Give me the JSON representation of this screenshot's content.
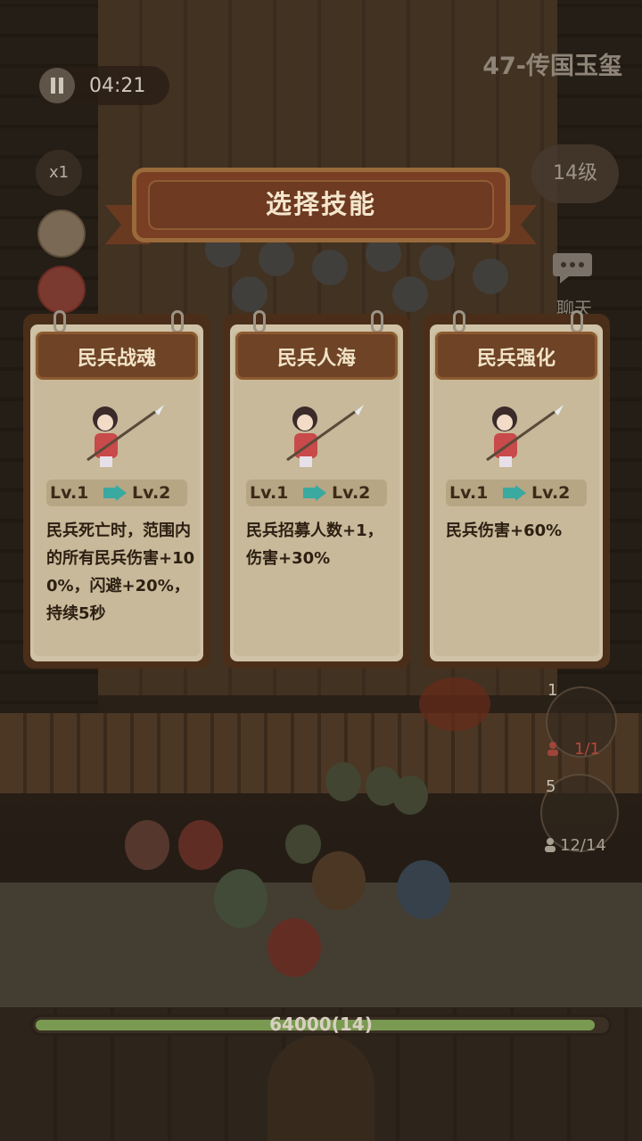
{
  "hud": {
    "timer": "04:21",
    "stage_title": "47-传国玉玺",
    "speed": "x1",
    "level": "14级",
    "chat_label": "聊天"
  },
  "dialog": {
    "title": "选择技能",
    "cards": [
      {
        "name": "民兵战魂",
        "level_from": "Lv.1",
        "level_to": "Lv.2",
        "description": "民兵死亡时，范围内的所有民兵伤害+100%，闪避+20%，持续5秒"
      },
      {
        "name": "民兵人海",
        "level_from": "Lv.1",
        "level_to": "Lv.2",
        "description": "民兵招募人数+1，伤害+30%"
      },
      {
        "name": "民兵强化",
        "level_from": "Lv.1",
        "level_to": "Lv.2",
        "description": "民兵伤害+60%"
      }
    ]
  },
  "units": [
    {
      "slot_number": "1",
      "count": "1/1"
    },
    {
      "slot_number": "5",
      "count": "12/14"
    }
  ],
  "wall_hp": {
    "label": "64000(14)",
    "fill_fraction": 0.98
  },
  "colors": {
    "card_header": "#6e4326",
    "card_paper": "#c7b999",
    "level_arrow": "#3aa9a0",
    "hp_fill": "#7a9a52"
  }
}
